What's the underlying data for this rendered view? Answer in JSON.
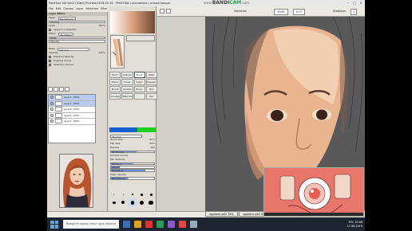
{
  "window": {
    "title": "PaintTool SAI Ver.2 (32bit) Preview.2018.05.18 - PNCFHNK | рисование | иллюстрация",
    "bandicam": {
      "www": "www.",
      "band": "BANDI",
      "cam": "CAM",
      "com": ".com"
    },
    "controls": [
      "–",
      "□",
      "×"
    ]
  },
  "menu": [
    "File",
    "Edit",
    "Canvas",
    "Layer",
    "Selection",
    "Filter",
    "Ruler",
    "Window",
    "Other"
  ],
  "toolbar": {
    "selection_label": "Selection",
    "zoom": "100%",
    "angle": "0.0°",
    "stabilizer_label": "Stabilizer",
    "stabilizer_value": "1"
  },
  "left_panel": {
    "section_title": "Layer Effect",
    "rows": [
      {
        "label": "Paper",
        "value": "No Texture"
      },
      {
        "label": "Intensity",
        "value": ""
      },
      {
        "label": "Scale",
        "value": "100%"
      },
      {
        "label": "",
        "value": "Apply to Lineworks"
      },
      {
        "label": "Effect",
        "value": "No Effect"
      },
      {
        "label": "Width",
        "value": ""
      },
      {
        "label": "Intensity",
        "value": ""
      },
      {
        "label": "Mode",
        "value": "Normal"
      },
      {
        "label": "Opacity",
        "value": "100%"
      }
    ],
    "checks": [
      "Preserve Opacity",
      "Clipping Group",
      "Selection Source"
    ],
    "layers": [
      {
        "name": "Layer3",
        "mode": "Normal",
        "opacity": "100%"
      },
      {
        "name": "Layer2",
        "mode": "Normal",
        "opacity": "100%"
      },
      {
        "name": "Layer8",
        "mode": "Normal",
        "opacity": "100%"
      },
      {
        "name": "Layer4",
        "mode": "Normal",
        "opacity": "100%"
      },
      {
        "name": "Layer1",
        "mode": "Normal",
        "opacity": "100%"
      }
    ]
  },
  "brush_panel": {
    "tools": [
      "Pencil",
      "AirBrush",
      "Brush",
      "Water",
      "Marker",
      "Eraser",
      "Select",
      "Deselect",
      "Bucket",
      "Gradate",
      "Binary",
      "Blur",
      "Smudge",
      "Watercolor",
      "",
      "Blur"
    ],
    "mode": "Normal",
    "brush_size_label": "Brush Size",
    "brush_size_value": "80.0",
    "min_size_label": "Min Size",
    "min_size_value": "50%",
    "density_label": "Density",
    "density_value": "100",
    "min_density_label": "Min Density",
    "shape": "[Simple Circle]",
    "texture": "[No Texture]",
    "blending_label": "Blending",
    "dilution_label": "Dilution",
    "persistence_label": "Persistence",
    "blur_pressure_label": "Blur Pressure",
    "keep_opacity": "Keep Opacity",
    "sizes": [
      "10",
      "20",
      "30",
      "40",
      "50",
      "60",
      "70",
      "80",
      "100",
      "120"
    ]
  },
  "doc_tabs": [
    {
      "name": "uppborn.sai2",
      "zoom": "78%"
    },
    {
      "name": "uppborn.sai2",
      "zoom": "98%"
    },
    {
      "name": "uppborn.sai2",
      "zoom": "85%"
    }
  ],
  "taskbar": {
    "search_placeholder": "Введите здесь текст для поиска",
    "time": "15:46",
    "date": "17.06.2019",
    "lang": "РУС"
  },
  "colors": {
    "canvas_bg": "#595959",
    "skin": "#e9b490",
    "hair": "#4a3026",
    "overlay_bg": "#e8766a"
  }
}
